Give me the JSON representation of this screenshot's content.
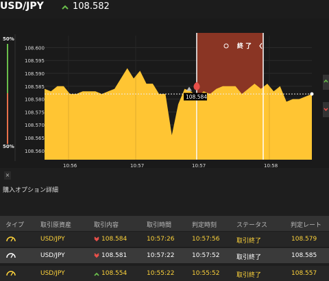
{
  "header": {
    "pair": "USD/JPY",
    "rate": "108.582",
    "rate_icon": "up-arrow-icon",
    "up_color": "#6abf4b"
  },
  "chart": {
    "percent_top": "50%",
    "percent_bottom": "50%",
    "yticks": [
      "108.600",
      "108.595",
      "108.590",
      "108.585",
      "108.580",
      "108.575",
      "108.570",
      "108.565",
      "108.560"
    ],
    "xticks": [
      "10:56",
      "10:57",
      "10:57",
      "10:58"
    ],
    "marker_value": "108.584",
    "end_label": "終 了",
    "area_color": "#ffc533",
    "end_zone_color": "#8a3524"
  },
  "chart_data": {
    "type": "area",
    "y": [
      108.584,
      108.583,
      108.585,
      108.585,
      108.582,
      108.582,
      108.583,
      108.583,
      108.583,
      108.582,
      108.583,
      108.584,
      108.588,
      108.592,
      108.588,
      108.591,
      108.586,
      108.586,
      108.582,
      108.582,
      108.566,
      108.578,
      108.584,
      108.583,
      108.581,
      108.583,
      108.582,
      108.584,
      108.585,
      108.585,
      108.585,
      108.582,
      108.584,
      108.586,
      108.584,
      108.586,
      108.583,
      108.585,
      108.579,
      108.58,
      108.58,
      108.581,
      108.582
    ],
    "ylim": [
      108.5565,
      108.6025
    ],
    "xticks": [
      "10:56",
      "10:57",
      "10:57",
      "10:58"
    ]
  },
  "section": {
    "title": "購入オプション詳細"
  },
  "table": {
    "headers": [
      "タイプ",
      "取引原資産",
      "取引内容",
      "取引時間",
      "判定時刻",
      "ステータス",
      "判定レート"
    ],
    "rows": [
      {
        "asset": "USD/JPY",
        "direction": "down",
        "value": "108.584",
        "time": "10:57:26",
        "judge": "10:57:56",
        "status": "取引終了",
        "rate": "108.579",
        "highlight": true
      },
      {
        "asset": "USD/JPY",
        "direction": "down",
        "value": "108.581",
        "time": "10:57:22",
        "judge": "10:57:52",
        "status": "取引終了",
        "rate": "108.585",
        "highlight": false
      },
      {
        "asset": "USD/JPY",
        "direction": "up",
        "value": "108.554",
        "time": "10:55:22",
        "judge": "10:55:52",
        "status": "取引終了",
        "rate": "108.557",
        "highlight": true
      }
    ]
  },
  "colors": {
    "highlight_text": "#ffd43b",
    "normal_text": "#ffffff",
    "down_color": "#e8504a",
    "up_color": "#6abf4b"
  }
}
